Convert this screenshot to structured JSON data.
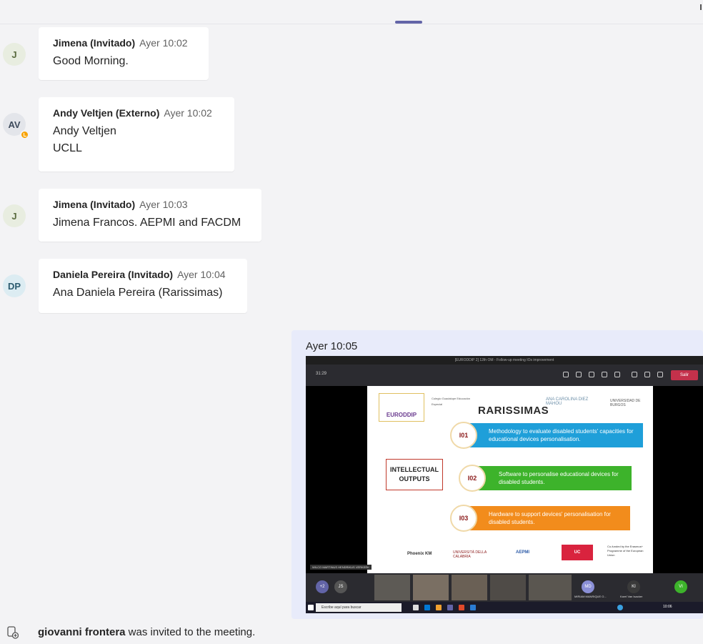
{
  "messages": [
    {
      "initials": "J",
      "author": "Jimena (Invitado)",
      "time": "Ayer 10:02",
      "lines": [
        "Good Morning."
      ]
    },
    {
      "initials": "AV",
      "author": "Andy Veltjen (Externo)",
      "time": "Ayer 10:02",
      "lines": [
        "Andy Veltjen",
        "UCLL"
      ]
    },
    {
      "initials": "J",
      "author": "Jimena (Invitado)",
      "time": "Ayer 10:03",
      "lines": [
        "Jimena Francos. AEPMI and FACDM"
      ]
    },
    {
      "initials": "DP",
      "author": "Daniela Pereira (Invitado)",
      "time": "Ayer 10:04",
      "lines": [
        "Ana Daniela Pereira (Rarissimas)"
      ]
    }
  ],
  "own_message": {
    "time": "Ayer 10:05",
    "screenshot": {
      "window_title": "[EURODDIP 2] 12th OM - Follow-up meeting IOs improvement",
      "call_time": "31:29",
      "leave_label": "Salir",
      "slide": {
        "logos": {
          "euroddip": "EURODDIP",
          "rarissimas": "RARISSIMAS",
          "ana_carolina": "ANA CAROLINA DIEZ MAHOU",
          "burgos": "UNIVERSIDAD DE BURGOS",
          "colegio": "Colegio Guadalupe Educación Especial"
        },
        "intellectual_outputs": "INTELLECTUAL OUTPUTS",
        "outputs": [
          {
            "code": "I01",
            "text": "Methodology to evaluate disabled students' capacities for educational devices personalisation."
          },
          {
            "code": "I02",
            "text": "Software to personalise educational devices for disabled students."
          },
          {
            "code": "I03",
            "text": "Hardware to support devices' personalisation for disabled students."
          }
        ],
        "partners": {
          "phoenix": "Phoenix KM",
          "calabria": "UNIVERSITÀ DELLA CALABRIA",
          "aepmi": "AEPMI",
          "uc": "UC",
          "eu": "Co-funded by the Erasmus+ Programme of the European Union"
        }
      },
      "speaker_name": "WILCO MARTINUS HENDRIKUS VERKERK",
      "participants": [
        "+2",
        "JS",
        "MD",
        "KI",
        "VI"
      ],
      "participant_labels": [
        "MIRIAM MANRIQUE O...",
        "Karel Van Isacker"
      ],
      "taskbar_search": "Escribe aquí para buscar",
      "clock": "10:06"
    }
  },
  "system_message": {
    "name": "giovanni frontera",
    "text": " was invited to the meeting."
  }
}
